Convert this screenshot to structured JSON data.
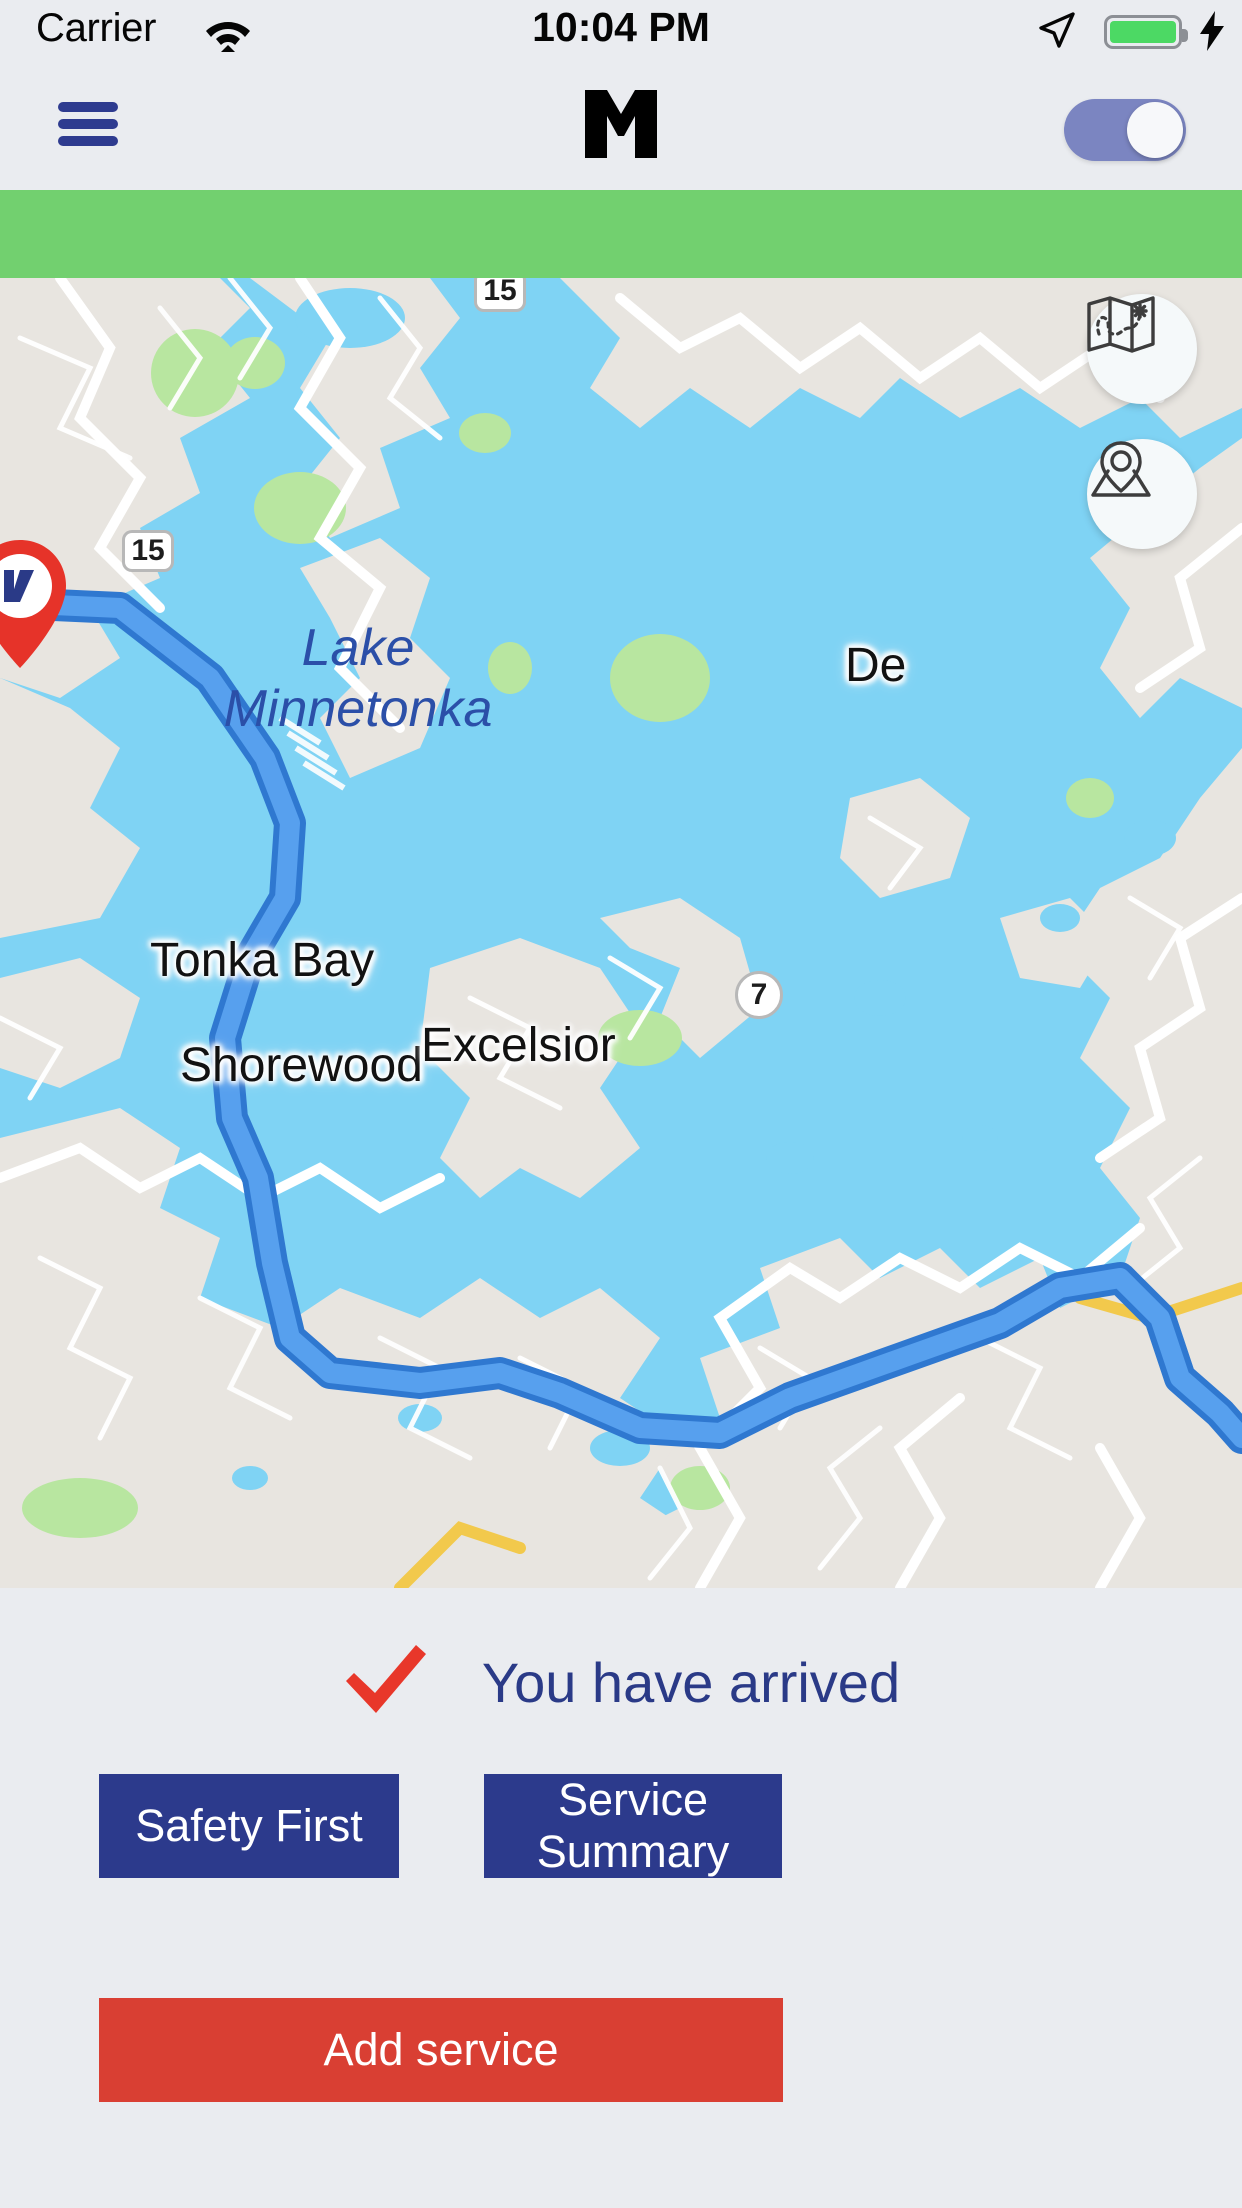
{
  "status_bar": {
    "carrier": "Carrier",
    "time": "10:04 PM",
    "wifi_icon": "wifi-icon",
    "location_icon": "location-arrow-icon",
    "battery_icon": "battery-icon",
    "charging_icon": "lightning-bolt-icon",
    "battery_color": "#4cd964"
  },
  "header": {
    "menu_icon": "hamburger-menu-icon",
    "logo": "M",
    "logo_name": "brand-logo-m",
    "toggle_state": "on",
    "toggle_color": "#7b85c1"
  },
  "banner": {
    "color": "#72d06f",
    "text": ""
  },
  "map": {
    "water_color": "#7fd3f4",
    "land_color": "#e8e5e0",
    "park_color": "#b8e6a0",
    "route_color": "#4a90e2",
    "route_outline": "#2f78d0",
    "labels": [
      {
        "name": "lake-label",
        "text_line1": "Lake",
        "text_line2": "Minnetonka",
        "style": "italic-blue"
      },
      {
        "name": "city-label-tonka-bay",
        "text": "Tonka Bay"
      },
      {
        "name": "city-label-shorewood",
        "text": "Shorewood"
      },
      {
        "name": "city-label-excelsior",
        "text": "Excelsior"
      },
      {
        "name": "city-label-deephaven",
        "text": "De"
      }
    ],
    "highway_shields": [
      {
        "name": "highway-shield-15-top",
        "label": "15",
        "shape": "rect"
      },
      {
        "name": "highway-shield-15-left",
        "label": "15",
        "shape": "rect"
      },
      {
        "name": "highway-shield-7",
        "label": "7",
        "shape": "circle"
      }
    ],
    "controls": [
      {
        "name": "map-route-button",
        "icon": "folded-map-icon"
      },
      {
        "name": "map-destination-button",
        "icon": "destination-pin-icon"
      }
    ],
    "origin_marker": {
      "name": "origin-pin-marker",
      "color": "#e63329"
    }
  },
  "bottom_panel": {
    "status_icon": "red-checkmark-icon",
    "status_icon_color": "#e8372a",
    "status_text": "You have arrived",
    "status_text_color": "#2a3a87",
    "buttons": [
      {
        "name": "safety-first-button",
        "label": "Safety First",
        "color": "#2c3a8c"
      },
      {
        "name": "service-summary-button",
        "label": "Service Summary",
        "color": "#2c3a8c"
      },
      {
        "name": "add-service-button",
        "label": "Add service",
        "color": "#d93f33"
      }
    ]
  }
}
